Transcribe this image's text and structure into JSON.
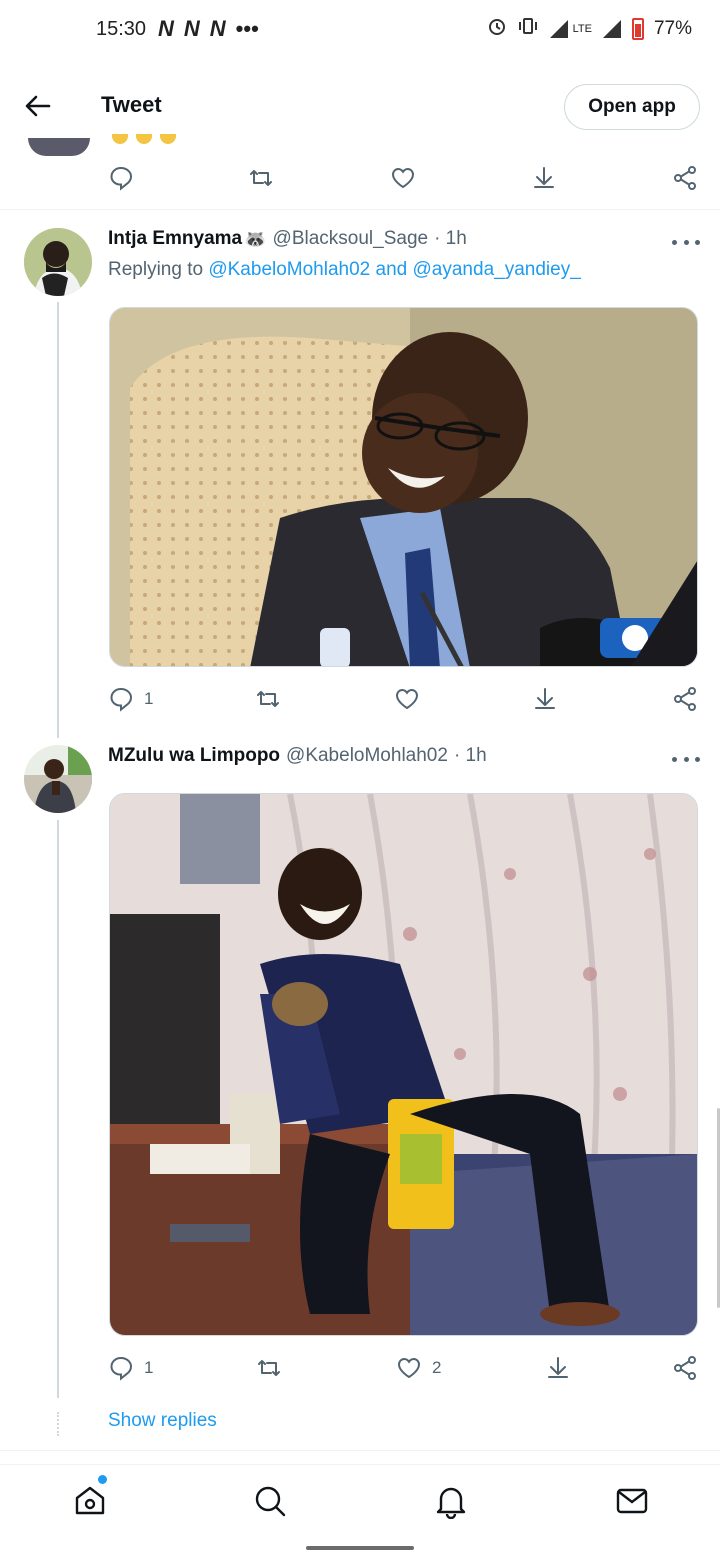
{
  "status_bar": {
    "time": "15:30",
    "left_icons": [
      "N",
      "N",
      "N",
      "•••"
    ],
    "network": "LTE",
    "battery": "77%"
  },
  "header": {
    "title": "Tweet",
    "open_app_label": "Open app"
  },
  "tweets": [
    {
      "name": "Intja Emnyama",
      "name_emoji": "🦝",
      "handle": "@Blacksoul_Sage",
      "time": "· 1h",
      "replying_prefix": "Replying to",
      "replying_to": [
        "@KabeloMohlah02",
        "and",
        "@ayanda_yandiey_"
      ],
      "media_alt": "Man in suit and glasses laughing at microphones",
      "actions": {
        "reply_count": "1",
        "retweet_count": "",
        "like_count": ""
      }
    },
    {
      "name": "MZulu wa Limpopo",
      "handle": "@KabeloMohlah02",
      "time": "· 1h",
      "media_alt": "Boy laughing holding a juice carton",
      "actions": {
        "reply_count": "1",
        "retweet_count": "",
        "like_count": "2"
      }
    }
  ],
  "show_replies_label": "Show replies",
  "bottom_nav": [
    "home-icon",
    "search-icon",
    "notifications-icon",
    "messages-icon"
  ],
  "colors": {
    "accent": "#1d9bf0",
    "text_secondary": "#536471",
    "border": "#cfd9de"
  }
}
